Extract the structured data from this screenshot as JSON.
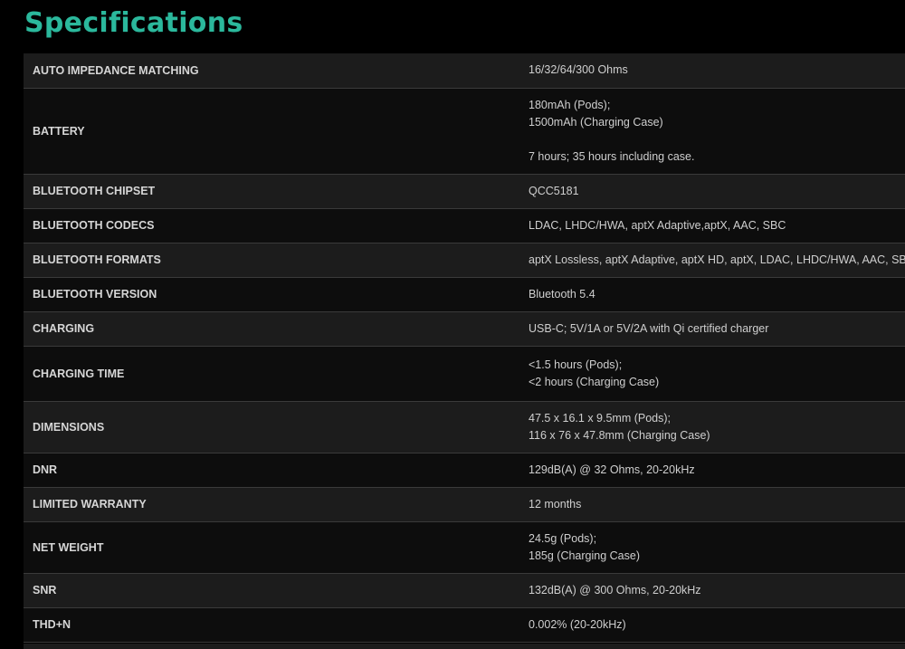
{
  "page": {
    "title": "Specifications"
  },
  "specs": [
    {
      "label": "AUTO IMPEDANCE MATCHING",
      "lines": [
        "16/32/64/300 Ohms"
      ]
    },
    {
      "label": "BATTERY",
      "lines": [
        "180mAh (Pods);",
        "1500mAh (Charging Case)",
        "",
        "7 hours; 35 hours including case."
      ]
    },
    {
      "label": "BLUETOOTH CHIPSET",
      "lines": [
        "QCC5181"
      ]
    },
    {
      "label": "BLUETOOTH CODECS",
      "lines": [
        "LDAC, LHDC/HWA, aptX Adaptive,aptX, AAC, SBC"
      ]
    },
    {
      "label": "BLUETOOTH FORMATS",
      "lines": [
        "aptX Lossless, aptX Adaptive, aptX HD, aptX, LDAC, LHDC/HWA, AAC, SBC"
      ]
    },
    {
      "label": "BLUETOOTH VERSION",
      "lines": [
        "Bluetooth 5.4"
      ]
    },
    {
      "label": "CHARGING",
      "lines": [
        "USB-C; 5V/1A or 5V/2A with Qi certified charger"
      ]
    },
    {
      "label": "CHARGING TIME",
      "lines": [
        "<1.5 hours (Pods);",
        "<2 hours (Charging Case)"
      ]
    },
    {
      "label": "DIMENSIONS",
      "lines": [
        "47.5 x 16.1 x 9.5mm (Pods);",
        "116 x 76 x 47.8mm (Charging Case)"
      ]
    },
    {
      "label": "DNR",
      "lines": [
        "129dB(A) @ 32 Ohms, 20-20kHz"
      ]
    },
    {
      "label": "LIMITED WARRANTY",
      "lines": [
        "12 months"
      ]
    },
    {
      "label": "NET WEIGHT",
      "lines": [
        "24.5g (Pods);",
        "185g (Charging Case)"
      ]
    },
    {
      "label": "SNR",
      "lines": [
        "132dB(A) @ 300 Ohms, 20-20kHz"
      ]
    },
    {
      "label": "THD+N",
      "lines": [
        "0.002% (20-20kHz)"
      ]
    }
  ]
}
